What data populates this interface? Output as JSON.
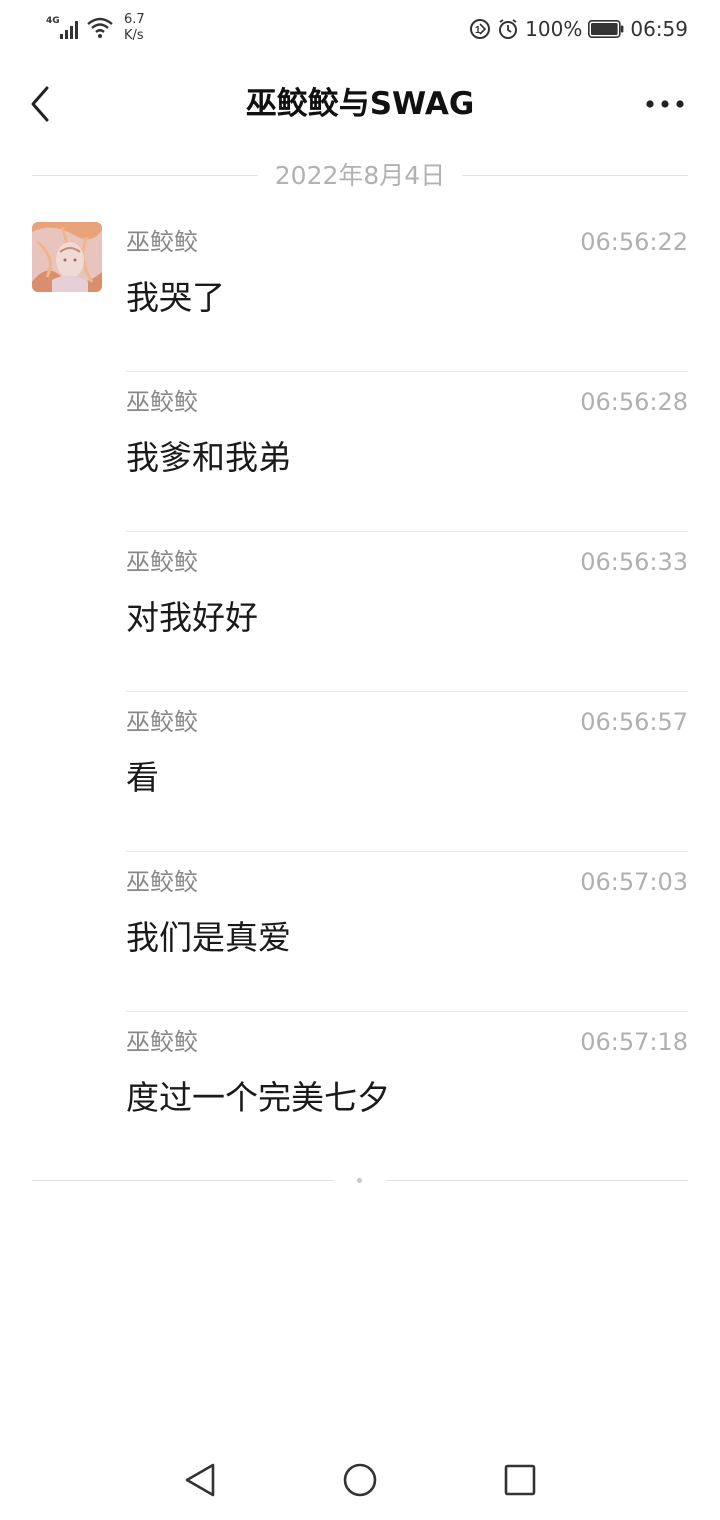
{
  "status_bar": {
    "network": "4G",
    "speed_value": "6.7",
    "speed_unit": "K/s",
    "battery": "100%",
    "time": "06:59",
    "icons": [
      "signal-icon",
      "wifi-icon",
      "data-saver-icon",
      "alarm-icon",
      "battery-icon"
    ]
  },
  "header": {
    "title": "巫鲛鲛与SWAG",
    "back_icon": "back-chevron-icon",
    "more_icon": "more-dots-icon"
  },
  "date_divider": "2022年8月4日",
  "messages": [
    {
      "sender": "巫鲛鲛",
      "time": "06:56:22",
      "text": "我哭了"
    },
    {
      "sender": "巫鲛鲛",
      "time": "06:56:28",
      "text": "我爹和我弟"
    },
    {
      "sender": "巫鲛鲛",
      "time": "06:56:33",
      "text": "对我好好"
    },
    {
      "sender": "巫鲛鲛",
      "time": "06:56:57",
      "text": "看"
    },
    {
      "sender": "巫鲛鲛",
      "time": "06:57:03",
      "text": "我们是真爱"
    },
    {
      "sender": "巫鲛鲛",
      "time": "06:57:18",
      "text": "度过一个完美七夕"
    }
  ],
  "nav_bar": [
    "nav-back-icon",
    "nav-home-icon",
    "nav-recent-icon"
  ],
  "colors": {
    "background": "#ffffff",
    "text_primary": "#1a1a1a",
    "text_secondary": "#888888",
    "timestamp": "#b0b0b0",
    "divider": "#e6e6e6"
  }
}
